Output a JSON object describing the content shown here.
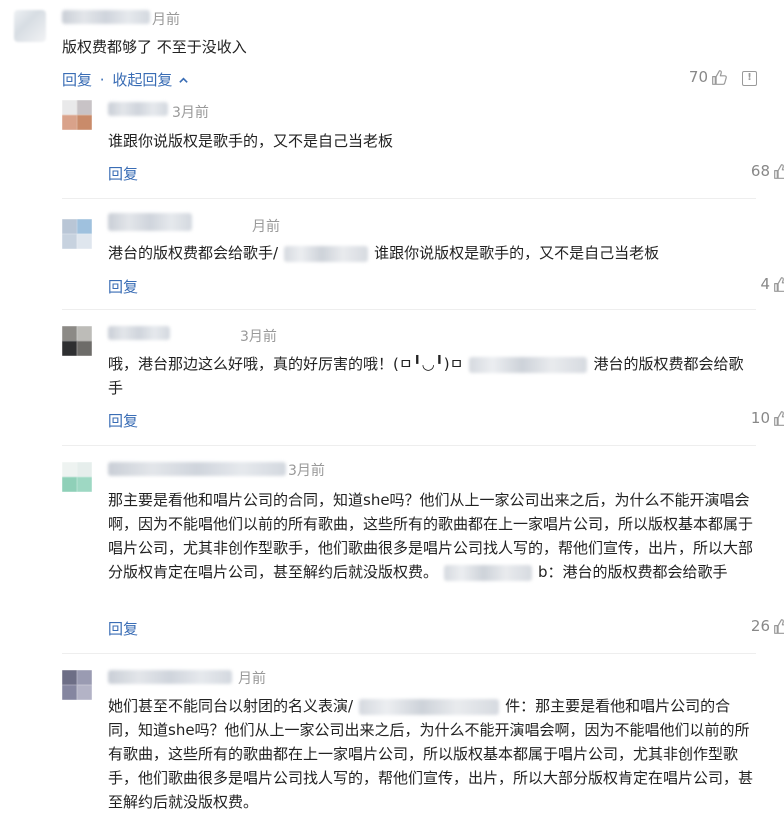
{
  "main": {
    "time": "月前",
    "text": "版权费都够了 不至于没收入",
    "reply_label": "回复",
    "separator": "·",
    "collapse_label": "收起回复",
    "likes": "70"
  },
  "replies": [
    {
      "time": "3月前",
      "text": "谁跟你说版权是歌手的，又不是自己当老板",
      "reply_label": "回复",
      "likes": "68"
    },
    {
      "time": "月前",
      "text_before": "港台的版权费都会给歌手/",
      "text_after": "谁跟你说版权是歌手的，又不是自己当老板",
      "reply_label": "回复",
      "likes": "4"
    },
    {
      "time": "3月前",
      "text_before": "哦，港台那边这么好哦，真的好厉害的哦！(ㅁ╹◡╹)ㅁ",
      "text_after": "港台的版权费都会给歌手",
      "reply_label": "回复",
      "likes": "10"
    },
    {
      "time": "3月前",
      "text_before": "那主要是看他和唱片公司的合同，知道she吗？他们从上一家公司出来之后，为什么不能开演唱会啊，因为不能唱他们以前的所有歌曲，这些所有的歌曲都在上一家唱片公司，所以版权基本都属于唱片公司，尤其非创作型歌手，他们歌曲很多是唱片公司找人写的，帮他们宣传，出片，所以大部分版权肯定在唱片公司，甚至解约后就没版权费。",
      "text_after": "b：港台的版权费都会给歌手",
      "reply_label": "回复",
      "likes": "26"
    },
    {
      "time": "月前",
      "text_before": "她们甚至不能同台以射团的名义表演/",
      "text_after": "件：那主要是看他和唱片公司的合同，知道she吗？他们从上一家公司出来之后，为什么不能开演唱会啊，因为不能唱他们以前的所有歌曲，这些所有的歌曲都在上一家唱片公司，所以版权基本都属于唱片公司，尤其非创作型歌手，他们歌曲很多是唱片公司找人写的，帮他们宣传，出片，所以大部分版权肯定在唱片公司，甚至解约后就没版权费。"
    }
  ],
  "colors": {
    "link": "#3a6db5",
    "meta": "#999999",
    "divider": "#eeeeee"
  },
  "icons": {
    "like": "thumbs-up-icon",
    "report": "report-icon",
    "collapse": "chevron-up-icon"
  }
}
